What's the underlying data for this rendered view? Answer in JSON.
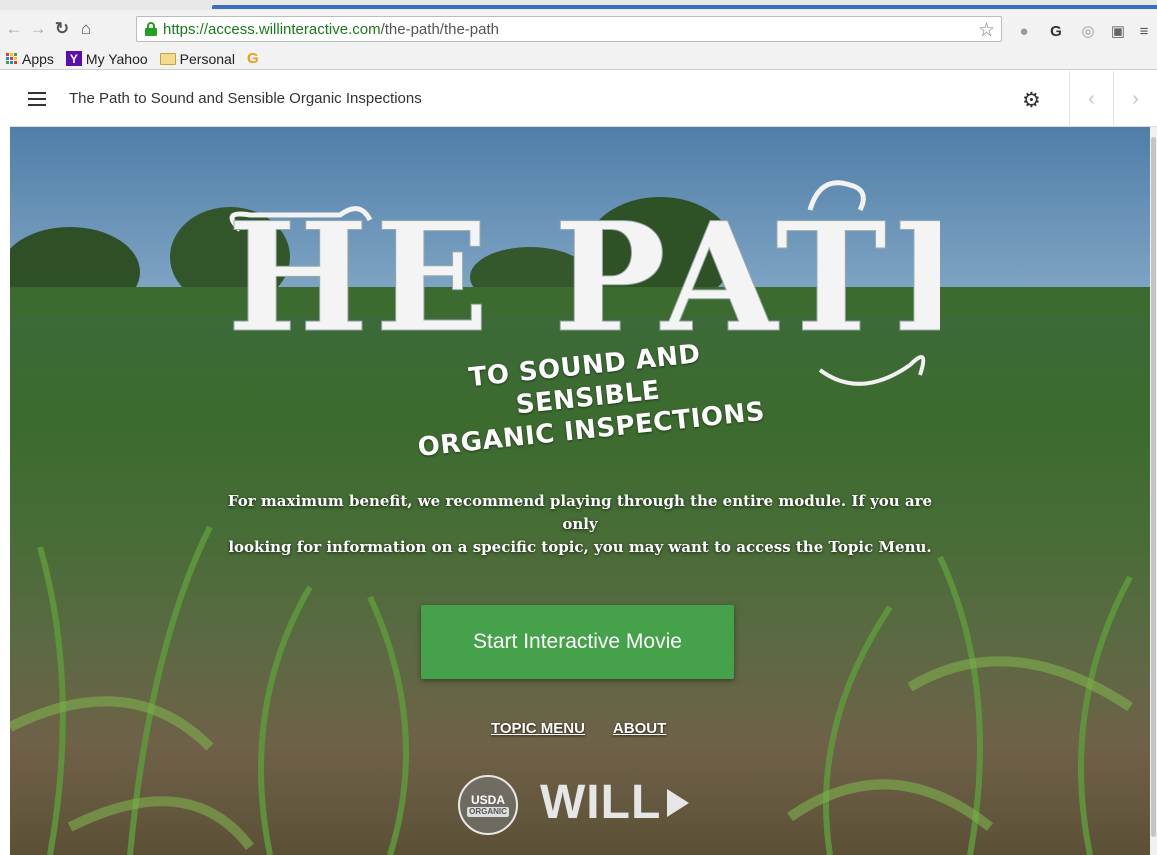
{
  "browser": {
    "url_host": "https://access.willinteractive.com",
    "url_path": "/the-path/the-path",
    "bookmarks": [
      {
        "label": "Apps",
        "icon": "apps-grid-icon"
      },
      {
        "label": "My Yahoo",
        "icon": "yahoo-icon"
      },
      {
        "label": "Personal",
        "icon": "folder-icon"
      },
      {
        "label": "",
        "icon": "google-icon"
      }
    ]
  },
  "app": {
    "title": "The Path to Sound and Sensible Organic Inspections"
  },
  "hero": {
    "title_main": "THE PATH",
    "subtitle_line1": "TO SOUND AND SENSIBLE",
    "subtitle_line2": "ORGANIC INSPECTIONS",
    "intro_line1": "For maximum benefit, we recommend playing through the entire module. If you are only",
    "intro_line2": "looking for information on a specific topic, you may want to access the Topic Menu.",
    "start_button": "Start Interactive Movie",
    "link_topic": "TOPIC MENU",
    "link_about": "ABOUT",
    "usda_top": "USDA",
    "usda_bottom": "ORGANIC",
    "brand": "WILL"
  },
  "colors": {
    "button_green": "#45a14a",
    "secure_green": "#21a021",
    "yahoo_purple": "#5b0eb0"
  }
}
